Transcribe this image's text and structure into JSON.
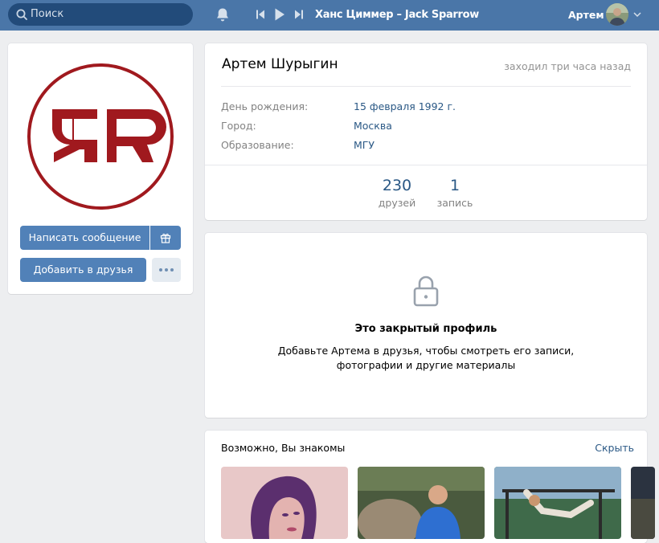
{
  "header": {
    "search_placeholder": "Поиск",
    "track": "Ханс Циммер – Jack Sparrow",
    "user_name": "Артем",
    "colors": {
      "bar": "#4a76a8",
      "search_bg": "#224b7a"
    }
  },
  "profile": {
    "name": "Артем Шурыгин",
    "last_seen": "заходил три часа назад",
    "info": [
      {
        "label": "День рождения:",
        "value": "15 февраля 1992 г."
      },
      {
        "label": "Город:",
        "value": "Москва"
      },
      {
        "label": "Образование:",
        "value": "МГУ"
      }
    ],
    "counters": [
      {
        "value": "230",
        "label": "друзей"
      },
      {
        "value": "1",
        "label": "запись"
      }
    ]
  },
  "actions": {
    "message_button": "Написать сообщение",
    "add_friend_button": "Добавить в друзья"
  },
  "closed_profile": {
    "title": "Это закрытый профиль",
    "text_line1": "Добавьте Артема в друзья, чтобы смотреть его записи,",
    "text_line2": "фотографии и другие материалы"
  },
  "suggestions": {
    "title": "Возможно, Вы знакомы",
    "hide_link": "Скрыть"
  },
  "icons": {
    "search": "search-icon",
    "bell": "bell-icon",
    "prev": "previous-track-icon",
    "play": "play-icon",
    "next": "next-track-icon",
    "chevron": "chevron-down-icon",
    "gift": "gift-icon",
    "more": "more-dots-icon",
    "lock": "lock-icon"
  }
}
